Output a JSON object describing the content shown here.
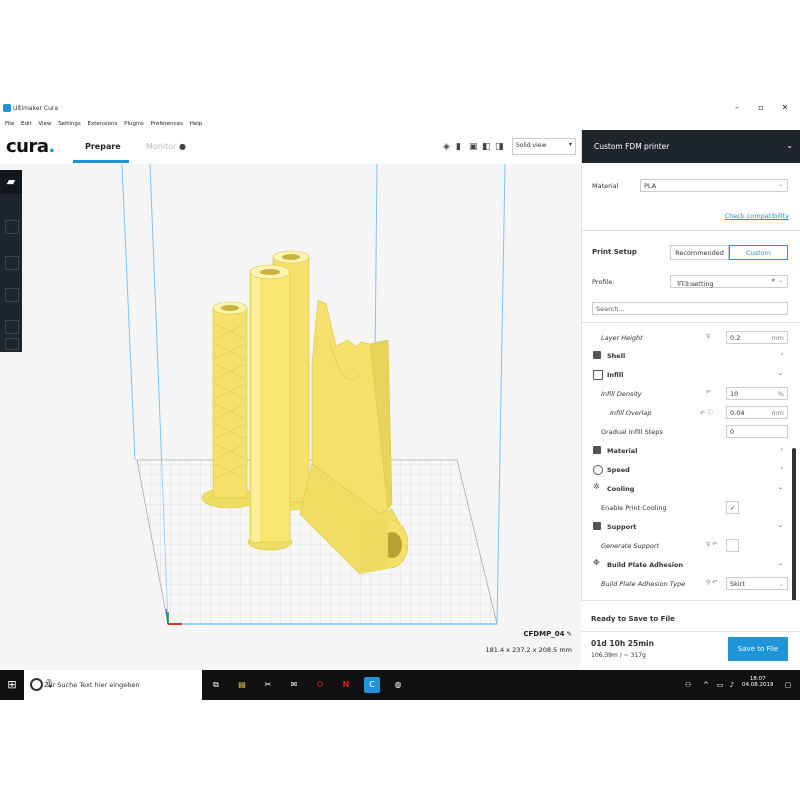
{
  "titlebar": {
    "title": "Ultimaker Cura",
    "minimize": "–",
    "maximize": "▫",
    "close": "✕"
  },
  "menu": [
    "File",
    "Edit",
    "View",
    "Settings",
    "Extensions",
    "Plugins",
    "Preferences",
    "Help"
  ],
  "header": {
    "brand": "cura",
    "brand_dot": ".",
    "tabs": {
      "prepare": "Prepare",
      "monitor": "Monitor"
    },
    "view_mode": "Solid view"
  },
  "object": {
    "name": "CFDMP_04",
    "dimensions": "181.4 x 237.2 x 208.5 mm"
  },
  "panel": {
    "printer": "Custom FDM printer",
    "material_label": "Material",
    "material_value": "PLA",
    "check_compat": "Check compatibility",
    "print_setup": "Print Setup",
    "recommended": "Recommended",
    "custom": "Custom",
    "profile_label": "Profile:",
    "profile_value": "TT1.setting",
    "profile_sub": "0.2mm",
    "search_placeholder": "Search...",
    "settings": [
      {
        "label": "Layer Height",
        "value": "0.2",
        "unit": "mm"
      },
      {
        "label": "Shell"
      },
      {
        "label": "Infill"
      },
      {
        "label": "Infill Density",
        "value": "10",
        "unit": "%"
      },
      {
        "label": "Infill Overlap",
        "value": "0.04",
        "unit": "mm"
      },
      {
        "label": "Gradual Infill Steps",
        "value": "0"
      },
      {
        "label": "Material"
      },
      {
        "label": "Speed"
      },
      {
        "label": "Cooling"
      },
      {
        "label": "Enable Print Cooling",
        "value": "✓"
      },
      {
        "label": "Support"
      },
      {
        "label": "Generate Support"
      },
      {
        "label": "Build Plate Adhesion"
      },
      {
        "label": "Build Plate Adhesion Type",
        "value": "Skirt"
      }
    ],
    "ready": "Ready to Save to File",
    "time": "01d 10h 25min",
    "usage": "106.39m / ~ 317g",
    "save_button": "Save to File"
  },
  "taskbar": {
    "search_placeholder": "Zur Suche Text hier eingeben",
    "time": "18:07",
    "date": "04.08.2018"
  },
  "colors": {
    "accent": "#2194d9",
    "dark": "#1f262b",
    "model": "#f5e16a"
  }
}
